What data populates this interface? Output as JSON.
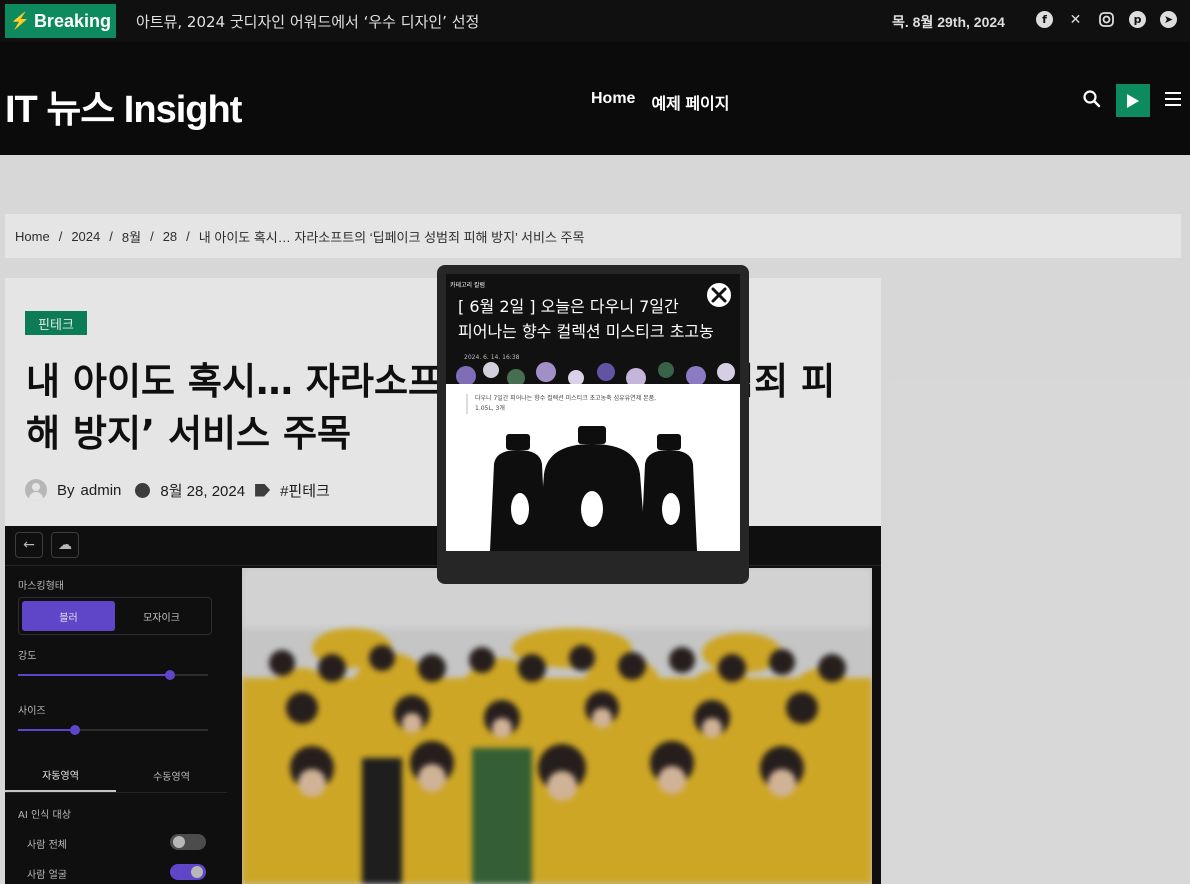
{
  "topbar": {
    "breaking_label": "Breaking",
    "ticker_text": "아트뮤, 2024 굿디자인 어워드에서 ‘우수 디자인’ 선정",
    "date": "목. 8월 29th, 2024",
    "social_icons": [
      "facebook-icon",
      "x-icon",
      "instagram-icon",
      "pinterest-icon",
      "telegram-icon"
    ]
  },
  "header": {
    "site_title": "IT 뉴스 Insight",
    "nav": [
      "Home",
      "예제 페이지"
    ]
  },
  "breadcrumb": [
    "Home",
    "2024",
    "8월",
    "28",
    "내 아이도 혹시… 자라소프트의 ‘딥페이크 성범죄 피해 방지’ 서비스 주목"
  ],
  "article": {
    "category": "핀테크",
    "title": "내 아이도 혹시… 자라소프트의 ‘딥페이크 성범죄 피해 방지’ 서비스 주목",
    "by_label": "By",
    "author": "admin",
    "date": "8월 28, 2024",
    "tag": "#핀테크"
  },
  "app_screenshot": {
    "masking_label": "마스킹형태",
    "seg_options": [
      "블러",
      "모자이크"
    ],
    "strength_label": "강도",
    "strength_level": 0.8,
    "size_label": "사이즈",
    "size_level": 0.3,
    "tabs": [
      "자동영역",
      "수동영역"
    ],
    "ai_target_label": "AI 인식 대상",
    "toggle_rows": [
      {
        "label": "사람 전체",
        "on": false
      },
      {
        "label": "사람 얼굴",
        "on": true
      }
    ]
  },
  "popup": {
    "brand": "카테고리 칼럼",
    "headline_line1": "[ 6월 2일 ] 오늘은 다우니 7일간",
    "headline_line2": "피어나는 향수 컬렉션 미스티크 초고농",
    "date": "2024. 6. 14. 16:38",
    "caption": "다우니 7일간 피어나는 향수 컬렉션 미스티크 초고농축 섬유유연제 본품, 1.05L, 3개"
  },
  "colors": {
    "accent": "#0d8b5f",
    "header_bg": "#0b0b0b",
    "topbar_bg": "#101010",
    "app_purple": "#6a4ee0"
  }
}
